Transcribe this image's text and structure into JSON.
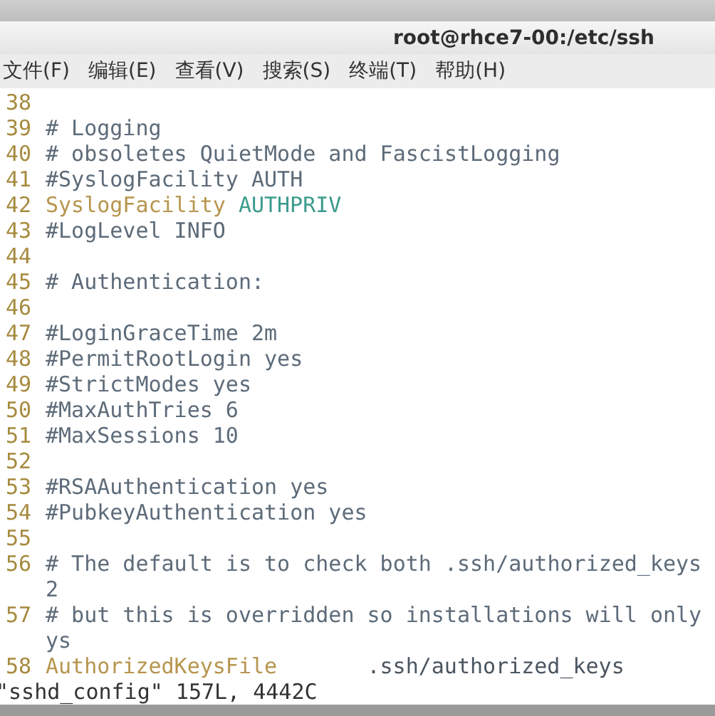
{
  "window": {
    "title": "root@rhce7-00:/etc/ssh"
  },
  "menu": [
    {
      "label": "文件(F)"
    },
    {
      "label": "编辑(E)"
    },
    {
      "label": "查看(V)"
    },
    {
      "label": "搜索(S)"
    },
    {
      "label": "终端(T)"
    },
    {
      "label": "帮助(H)"
    }
  ],
  "lines": [
    {
      "number": "38",
      "kind": "blank"
    },
    {
      "number": "39",
      "kind": "comment",
      "text": "# Logging"
    },
    {
      "number": "40",
      "kind": "comment",
      "text": "# obsoletes QuietMode and FascistLogging"
    },
    {
      "number": "41",
      "kind": "comment",
      "text": "#SyslogFacility AUTH"
    },
    {
      "number": "42",
      "kind": "directive",
      "key": "SyslogFacility",
      "value": {
        "text": "AUTHPRIV",
        "color": "#3b9b8c"
      }
    },
    {
      "number": "43",
      "kind": "comment",
      "text": "#LogLevel INFO"
    },
    {
      "number": "44",
      "kind": "blank"
    },
    {
      "number": "45",
      "kind": "comment",
      "text": "# Authentication:"
    },
    {
      "number": "46",
      "kind": "blank"
    },
    {
      "number": "47",
      "kind": "comment",
      "text": "#LoginGraceTime 2m"
    },
    {
      "number": "48",
      "kind": "comment",
      "text": "#PermitRootLogin yes"
    },
    {
      "number": "49",
      "kind": "comment",
      "text": "#StrictModes yes"
    },
    {
      "number": "50",
      "kind": "comment",
      "text": "#MaxAuthTries 6"
    },
    {
      "number": "51",
      "kind": "comment",
      "text": "#MaxSessions 10"
    },
    {
      "number": "52",
      "kind": "blank"
    },
    {
      "number": "53",
      "kind": "comment",
      "text": "#RSAAuthentication yes"
    },
    {
      "number": "54",
      "kind": "comment",
      "text": "#PubkeyAuthentication yes"
    },
    {
      "number": "55",
      "kind": "blank"
    },
    {
      "number": "56",
      "kind": "comment",
      "text": "# The default is to check both .ssh/authorized_keys",
      "wrap": "2"
    },
    {
      "number": "57",
      "kind": "comment",
      "text": "# but this is overridden so installations will only",
      "wrap": "ys"
    },
    {
      "number": "58",
      "kind": "directive",
      "key": "AuthorizedKeysFile",
      "value": {
        "text": "      .ssh/authorized_keys",
        "color": "#4a5560"
      }
    }
  ],
  "status_line": "\"sshd_config\" 157L, 4442C"
}
